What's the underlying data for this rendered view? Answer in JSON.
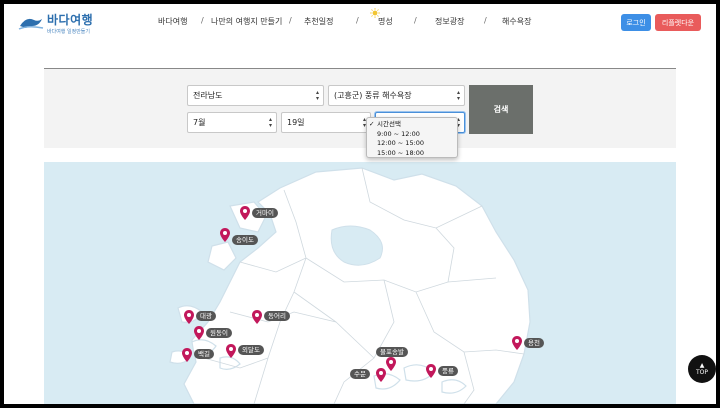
{
  "header": {
    "logo_title": "바다여행",
    "logo_subtitle": "바다여행 일정만들기",
    "nav": [
      "바다여행",
      "나만의 여행지 만들기",
      "추천일정",
      "명성",
      "정보광장",
      "해수욕장"
    ],
    "login_label": "로그인",
    "logout_label": "리플렛다운"
  },
  "search": {
    "region": "전라남도",
    "beach": "(고흥군) 풍류 해수욕장",
    "month": "7월",
    "day": "19일",
    "time": "",
    "search_label": "검색",
    "time_options": [
      "시간선택",
      "9:00 ~ 12:00",
      "12:00 ~ 15:00",
      "15:00 ~ 18:00"
    ],
    "time_selected_index": 0
  },
  "map": {
    "markers": [
      "거마이",
      "송이도",
      "대광",
      "동어리",
      "원동이",
      "백길",
      "외달도",
      "물포송발",
      "수문",
      "풍류",
      "용천"
    ]
  },
  "top_label": "TOP",
  "colors": {
    "accent": "#3d8fe6",
    "logout": "#e95b5b",
    "search_button": "#6b6f6b",
    "marker": "#c2185b",
    "sea": "#d8ebf3",
    "land": "#ffffff"
  }
}
